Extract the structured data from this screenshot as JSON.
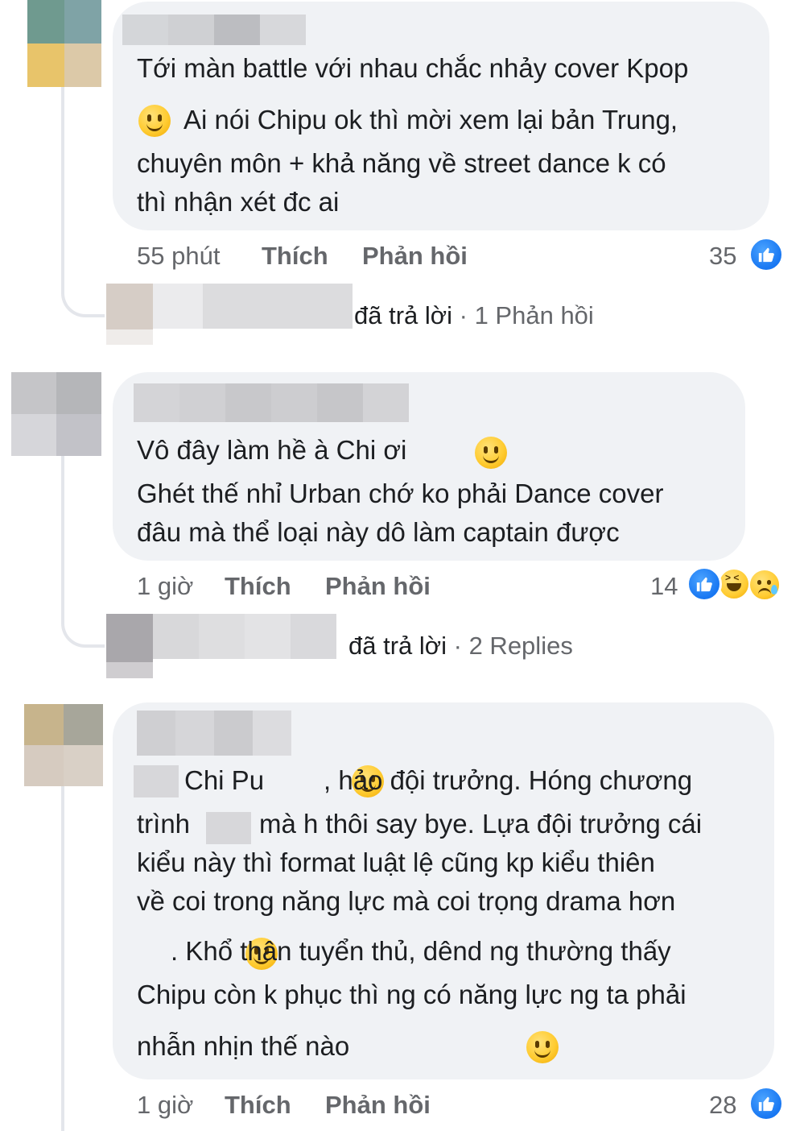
{
  "comments": [
    {
      "lines": [
        "Tới màn battle với nhau chắc nhảy cover Kpop",
        "Ai nói Chipu ok thì mời xem lại bản Trung,",
        "chuyên môn + khả năng về street dance k có",
        "thì nhận xét đc ai"
      ],
      "time": "55 phút",
      "like_label": "Thích",
      "reply_label": "Phản hồi",
      "reaction_count": "35",
      "reply_summary": {
        "replied": "đã trả lời",
        "sep": "·",
        "count": "1 Phản hồi"
      }
    },
    {
      "lines": [
        "Vô đây làm hề à Chi ơi",
        "Ghét thế nhỉ Urban chớ ko phải Dance cover",
        "đâu mà thể loại này dô làm captain được"
      ],
      "time": "1 giờ",
      "like_label": "Thích",
      "reply_label": "Phản hồi",
      "reaction_count": "14",
      "reply_summary": {
        "replied": "đã trả lời",
        "sep": "·",
        "count": "2 Replies"
      }
    },
    {
      "lines": [
        "Chi Pu",
        ", hảo đội trưởng. Hóng chương",
        "trình",
        "mà h thôi say bye. Lựa đội trưởng cái",
        "kiểu này thì format luật lệ cũng kp kiểu thiên",
        "về coi trong năng lực mà coi trọng drama hơn",
        ". Khổ thân tuyển thủ, dênd ng thường thấy",
        "Chipu còn k phục thì ng có năng lực ng ta phải",
        "nhẫn nhịn thế nào"
      ],
      "time": "1 giờ",
      "like_label": "Thích",
      "reply_label": "Phản hồi",
      "reaction_count": "28"
    }
  ],
  "icons": {
    "like": "like-reaction-icon",
    "haha": "haha-reaction-icon",
    "sad": "sad-reaction-icon",
    "emoji": "smiley-emoji-icon"
  },
  "colors": {
    "bubble": "#f0f2f5",
    "text": "#1c1e21",
    "meta": "#65676b",
    "like_blue": "#1877f2"
  }
}
